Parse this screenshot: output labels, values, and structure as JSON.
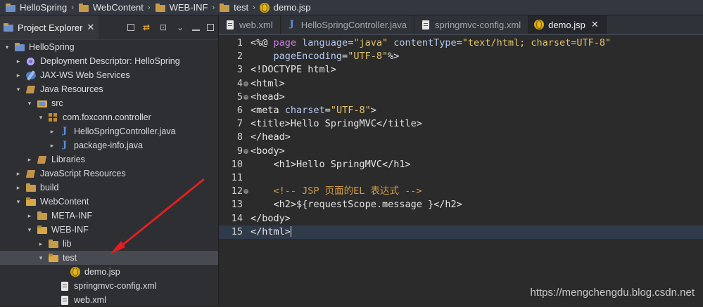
{
  "breadcrumb": [
    {
      "label": "HelloSpring",
      "icon": "project-icon"
    },
    {
      "label": "WebContent",
      "icon": "folder-icon"
    },
    {
      "label": "WEB-INF",
      "icon": "folder-icon"
    },
    {
      "label": "test",
      "icon": "folder-icon"
    },
    {
      "label": "demo.jsp",
      "icon": "jsp-file-icon"
    }
  ],
  "explorer": {
    "title": "Project Explorer",
    "close_glyph": "✕",
    "tree": [
      {
        "label": "HelloSpring",
        "arrow": "▾",
        "icon": "project-icon",
        "indent": 0
      },
      {
        "label": "Deployment Descriptor: HelloSpring",
        "arrow": "▸",
        "icon": "deployment-descriptor-icon",
        "indent": 1
      },
      {
        "label": "JAX-WS Web Services",
        "arrow": "▸",
        "icon": "web-services-icon",
        "indent": 1
      },
      {
        "label": "Java Resources",
        "arrow": "▾",
        "icon": "java-resources-icon",
        "indent": 1
      },
      {
        "label": "src",
        "arrow": "▾",
        "icon": "source-folder-icon",
        "indent": 2
      },
      {
        "label": "com.foxconn.controller",
        "arrow": "▾",
        "icon": "package-icon",
        "indent": 3
      },
      {
        "label": "HelloSpringController.java",
        "arrow": "▸",
        "icon": "java-file-icon",
        "indent": 4
      },
      {
        "label": "package-info.java",
        "arrow": "▸",
        "icon": "java-file-icon",
        "indent": 4
      },
      {
        "label": "Libraries",
        "arrow": "▸",
        "icon": "libraries-icon",
        "indent": 2
      },
      {
        "label": "JavaScript Resources",
        "arrow": "▸",
        "icon": "javascript-resources-icon",
        "indent": 1
      },
      {
        "label": "build",
        "arrow": "▸",
        "icon": "folder-icon",
        "indent": 1
      },
      {
        "label": "WebContent",
        "arrow": "▾",
        "icon": "folder-open-icon",
        "indent": 1
      },
      {
        "label": "META-INF",
        "arrow": "▸",
        "icon": "folder-icon",
        "indent": 2
      },
      {
        "label": "WEB-INF",
        "arrow": "▾",
        "icon": "folder-open-icon",
        "indent": 2
      },
      {
        "label": "lib",
        "arrow": "▸",
        "icon": "folder-icon",
        "indent": 3
      },
      {
        "label": "test",
        "arrow": "▾",
        "icon": "folder-open-icon",
        "indent": 3,
        "selected": true
      },
      {
        "label": "demo.jsp",
        "arrow": "",
        "icon": "jsp-file-icon",
        "indent": 5
      },
      {
        "label": "springmvc-config.xml",
        "arrow": "",
        "icon": "xml-file-icon",
        "indent": 4
      },
      {
        "label": "web.xml",
        "arrow": "",
        "icon": "xml-file-icon",
        "indent": 4
      }
    ]
  },
  "tabs": [
    {
      "label": "web.xml",
      "icon": "xml-file-icon",
      "active": false
    },
    {
      "label": "HelloSpringController.java",
      "icon": "java-file-icon",
      "active": false
    },
    {
      "label": "springmvc-config.xml",
      "icon": "xml-file-icon",
      "active": false
    },
    {
      "label": "demo.jsp",
      "icon": "jsp-file-icon",
      "active": true
    }
  ],
  "tab_close_glyph": "✕",
  "code": [
    {
      "n": "1",
      "fold": false,
      "tokens": [
        [
          "t-tag",
          "<%@ "
        ],
        [
          "t-kw",
          "page"
        ],
        [
          "t-attr",
          " language"
        ],
        [
          "t-tag",
          "="
        ],
        [
          "t-str",
          "\"java\""
        ],
        [
          "t-attr",
          " contentType"
        ],
        [
          "t-tag",
          "="
        ],
        [
          "t-str",
          "\"text/html; charset=UTF-8\""
        ]
      ]
    },
    {
      "n": "2",
      "fold": false,
      "tokens": [
        [
          "t-attr",
          "    pageEncoding"
        ],
        [
          "t-tag",
          "="
        ],
        [
          "t-str",
          "\"UTF-8\""
        ],
        [
          "t-tag",
          "%>"
        ]
      ]
    },
    {
      "n": "3",
      "fold": false,
      "tokens": [
        [
          "t-tag",
          "<!DOCTYPE html>"
        ]
      ]
    },
    {
      "n": "4",
      "fold": true,
      "tokens": [
        [
          "t-tag",
          "<html>"
        ]
      ]
    },
    {
      "n": "5",
      "fold": true,
      "tokens": [
        [
          "t-tag",
          "<head>"
        ]
      ]
    },
    {
      "n": "6",
      "fold": false,
      "tokens": [
        [
          "t-tag",
          "<meta"
        ],
        [
          "t-attr",
          " charset"
        ],
        [
          "t-tag",
          "="
        ],
        [
          "t-str",
          "\"UTF-8\""
        ],
        [
          "t-tag",
          ">"
        ]
      ]
    },
    {
      "n": "7",
      "fold": false,
      "tokens": [
        [
          "t-tag",
          "<title>"
        ],
        [
          "t-text",
          "Hello SpringMVC"
        ],
        [
          "t-tag",
          "</title>"
        ]
      ]
    },
    {
      "n": "8",
      "fold": false,
      "tokens": [
        [
          "t-tag",
          "</head>"
        ]
      ]
    },
    {
      "n": "9",
      "fold": true,
      "tokens": [
        [
          "t-tag",
          "<body>"
        ]
      ]
    },
    {
      "n": "10",
      "fold": false,
      "tokens": [
        [
          "t-tag",
          "    <h1>"
        ],
        [
          "t-text",
          "Hello SpringMVC"
        ],
        [
          "t-tag",
          "</h1>"
        ]
      ]
    },
    {
      "n": "11",
      "fold": false,
      "tokens": []
    },
    {
      "n": "12",
      "fold": true,
      "tokens": [
        [
          "t-comment",
          "    <!-- JSP 页面的EL 表达式 -->"
        ]
      ]
    },
    {
      "n": "13",
      "fold": false,
      "tokens": [
        [
          "t-tag",
          "    <h2>"
        ],
        [
          "t-text",
          "${requestScope.message }"
        ],
        [
          "t-tag",
          "</h2>"
        ]
      ]
    },
    {
      "n": "14",
      "fold": false,
      "tokens": [
        [
          "t-tag",
          "</body>"
        ]
      ]
    },
    {
      "n": "15",
      "fold": false,
      "current": true,
      "tokens": [
        [
          "t-tag",
          "</html>"
        ]
      ]
    }
  ],
  "watermark": "https://mengchengdu.blog.csdn.net",
  "colors": {
    "annotation_arrow": "#e02020",
    "selection": "#474a50"
  }
}
